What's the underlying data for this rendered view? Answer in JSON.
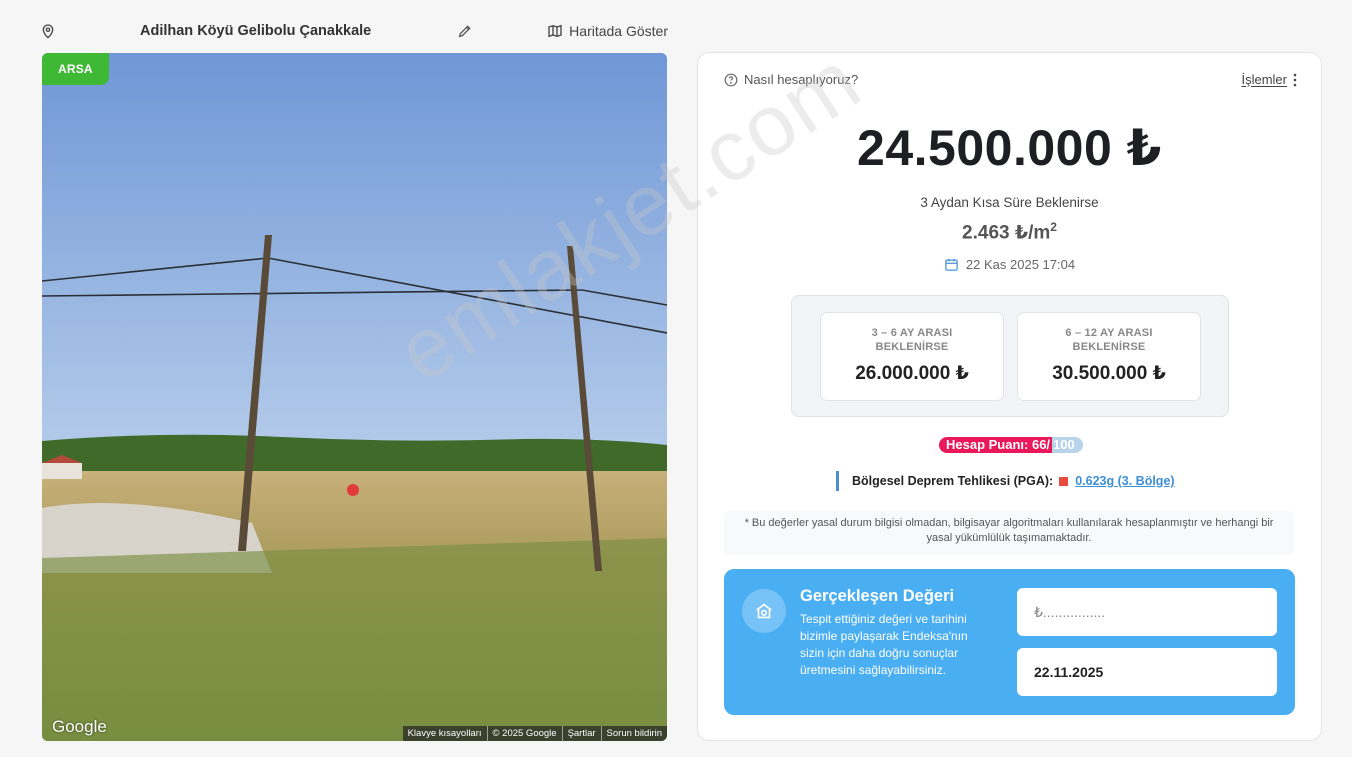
{
  "header": {
    "address": "Adilhan Köyü Gelibolu Çanakkale",
    "map_link": "Haritada Göster"
  },
  "photo": {
    "badge": "ARSA",
    "google_logo": "Google",
    "attribution": [
      "Klavye kısayolları",
      "© 2025 Google",
      "Şartlar",
      "Sorun bildirin"
    ]
  },
  "valuation": {
    "how_label": "Nasıl hesaplıyoruz?",
    "ops_label": "İşlemler",
    "price": "24.500.000 ₺",
    "short_term": "3 Aydan Kısa Süre Beklenirse",
    "per_m2": "2.463 ₺/m",
    "per_m2_sup": "2",
    "date": "22 Kas 2025 17:04",
    "scenarios": [
      {
        "title": "3 – 6 AY ARASI BEKLENİRSE",
        "value": "26.000.000 ₺"
      },
      {
        "title": "6 – 12 AY ARASI BEKLENİRSE",
        "value": "30.500.000 ₺"
      }
    ],
    "score_label": "Hesap Puanı: 66/",
    "score_max": "100",
    "quake_label": "Bölgesel Deprem Tehlikesi (PGA):",
    "quake_value": "0.623g (3. Bölge)",
    "note": "* Bu değerler yasal durum bilgisi olmadan, bilgisayar algoritmaları kullanılarak hesaplanmıştır ve herhangi bir yasal yükümlülük taşımamaktadır."
  },
  "realized": {
    "title": "Gerçekleşen Değeri",
    "description": "Tespit ettiğiniz değeri ve tarihini bizimle paylaşarak Endeksa'nın sizin için daha doğru sonuçlar üretmesini sağlayabilirsiniz.",
    "price_placeholder": "₺................",
    "date_value": "22.11.2025"
  },
  "watermark": "emlakjet.com",
  "colors": {
    "badge_green": "#3fb935",
    "score_pink": "#e8185a",
    "realized_blue": "#4aaef3",
    "quake_red": "#e74c3c"
  }
}
